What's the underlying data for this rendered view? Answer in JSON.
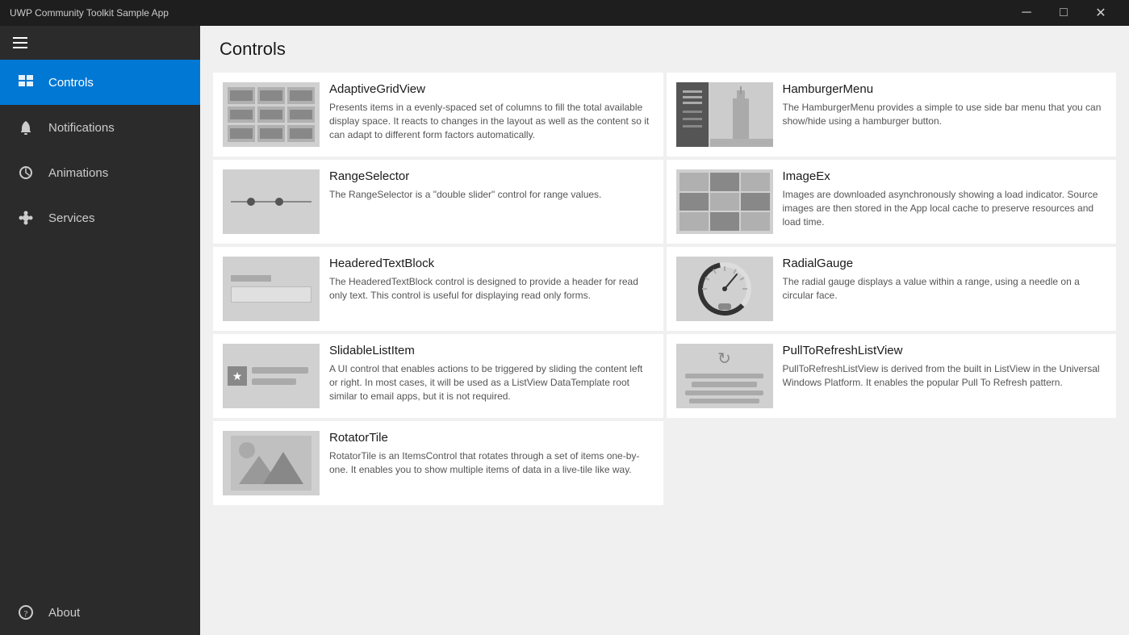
{
  "titleBar": {
    "title": "UWP Community Toolkit Sample App",
    "minimize": "─",
    "maximize": "□",
    "close": "✕"
  },
  "sidebar": {
    "hamburgerLabel": "Menu",
    "items": [
      {
        "id": "controls",
        "label": "Controls",
        "icon": "controls-icon",
        "active": true
      },
      {
        "id": "notifications",
        "label": "Notifications",
        "icon": "notifications-icon",
        "active": false
      },
      {
        "id": "animations",
        "label": "Animations",
        "icon": "animations-icon",
        "active": false
      },
      {
        "id": "services",
        "label": "Services",
        "icon": "services-icon",
        "active": false
      }
    ],
    "bottomItems": [
      {
        "id": "about",
        "label": "About",
        "icon": "about-icon"
      }
    ]
  },
  "content": {
    "title": "Controls",
    "cards": [
      {
        "id": "adaptive-grid-view",
        "name": "AdaptiveGridView",
        "description": "Presents items in a evenly-spaced set of columns to fill the total available display space. It reacts to changes in the layout as well as the content so it can adapt to different form factors automatically.",
        "thumbnail": "adaptive"
      },
      {
        "id": "hamburger-menu",
        "name": "HamburgerMenu",
        "description": "The HamburgerMenu provides a simple to use side bar menu that you can show/hide using a hamburger button.",
        "thumbnail": "hamburger"
      },
      {
        "id": "range-selector",
        "name": "RangeSelector",
        "description": "The RangeSelector is a \"double slider\" control for range values.",
        "thumbnail": "range"
      },
      {
        "id": "image-ex",
        "name": "ImageEx",
        "description": "Images are downloaded asynchronously showing a load indicator. Source images are then stored in the App local cache to preserve resources and load time.",
        "thumbnail": "imageex"
      },
      {
        "id": "headered-text-block",
        "name": "HeaderedTextBlock",
        "description": "The HeaderedTextBlock control is designed to provide a header for read only text. This control is useful for displaying read only forms.",
        "thumbnail": "headered"
      },
      {
        "id": "radial-gauge",
        "name": "RadialGauge",
        "description": "The radial gauge displays a value within a range, using a needle on a circular face.",
        "thumbnail": "radial"
      },
      {
        "id": "slidable-list-item",
        "name": "SlidableListItem",
        "description": "A UI control that enables actions to be triggered by sliding the content left or right. In most cases, it will be used as a ListView DataTemplate root similar to email apps, but it is not required.",
        "thumbnail": "slidable"
      },
      {
        "id": "pull-to-refresh",
        "name": "PullToRefreshListView",
        "description": "PullToRefreshListView is derived from the built in ListView in the Universal Windows Platform. It enables the popular Pull To Refresh pattern.",
        "thumbnail": "pullrefresh"
      },
      {
        "id": "rotator-tile",
        "name": "RotatorTile",
        "description": "RotatorTile is an ItemsControl that rotates through a set of items one-by-one. It enables you to show multiple items of data in a live-tile like way.",
        "thumbnail": "rotator"
      }
    ]
  }
}
